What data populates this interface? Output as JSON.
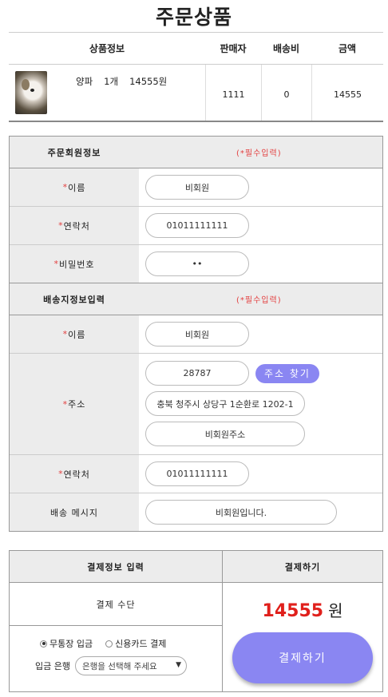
{
  "page": {
    "title": "주문상품"
  },
  "product_table": {
    "headers": [
      "상품정보",
      "판매자",
      "배송비",
      "금액"
    ],
    "item": {
      "name": "양파",
      "qty": "1개",
      "price_text": "14555원",
      "seller": "1111",
      "shipping": "0",
      "amount": "14555"
    }
  },
  "orderer": {
    "section_title": "주문회원정보",
    "required_note": "(*필수입력)",
    "star": "*",
    "name_label": "이름",
    "name_value": "비회원",
    "phone_label": "연락처",
    "phone_value": "01011111111",
    "password_label": "비밀번호",
    "password_value": "••"
  },
  "shipping": {
    "section_title": "배송지정보입력",
    "required_note": "(*필수입력)",
    "star": "*",
    "name_label": "이름",
    "name_value": "비회원",
    "address_label": "주소",
    "zipcode": "28787",
    "address_search_label": "주소 찾기",
    "address_line1": "충북 청주시 상당구 1순환로 1202-1",
    "address_line2": "비회원주소",
    "phone_label": "연락처",
    "phone_value": "01011111111",
    "message_label": "배송 메시지",
    "message_value": "비회원입니다."
  },
  "payment": {
    "info_header": "결제정보 입력",
    "pay_header": "결제하기",
    "method_label": "결제 수단",
    "option_bank": "무통장 입금",
    "option_card": "신용카드 결제",
    "bank_label": "입금 은행",
    "bank_select": "은행을 선택해 주세요",
    "total_amount": "14555",
    "currency": "원",
    "pay_button": "결제하기"
  }
}
